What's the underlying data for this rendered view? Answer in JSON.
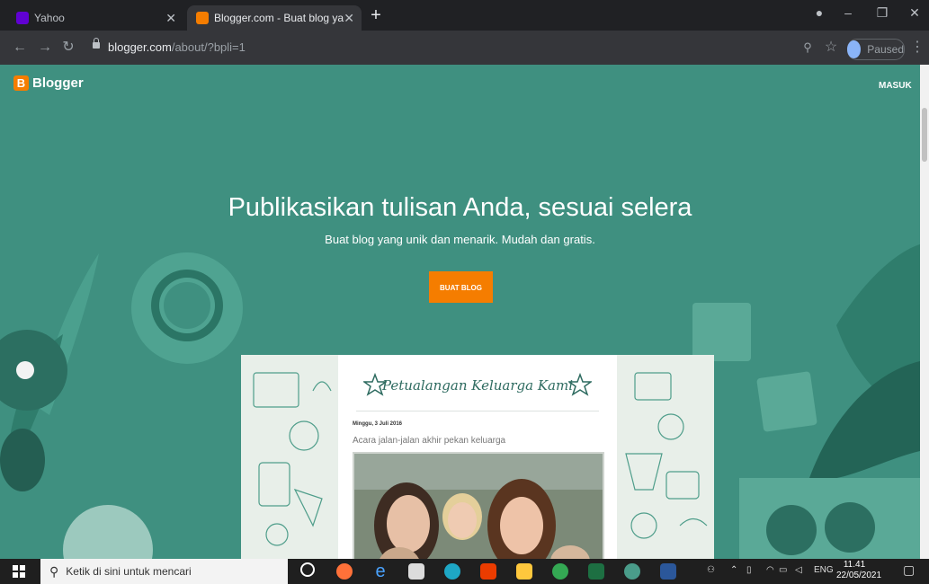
{
  "browser": {
    "tabs": [
      {
        "title": "Yahoo",
        "active": false
      },
      {
        "title": "Blogger.com - Buat blog yang u",
        "active": true
      }
    ],
    "url_host": "blogger.com",
    "url_path": "/about/?bpli=1",
    "profile_status": "Paused"
  },
  "page": {
    "logo_text": "Blogger",
    "signin_label": "MASUK",
    "headline": "Publikasikan tulisan Anda, sesuai selera",
    "subheadline": "Buat blog yang unik dan menarik. Mudah dan gratis.",
    "cta_label": "BUAT BLOG",
    "preview": {
      "blog_title": "Petualangan Keluarga Kami",
      "post_date": "Minggu, 3 Juli 2016",
      "post_title": "Acara jalan-jalan akhir pekan keluarga"
    }
  },
  "taskbar": {
    "search_placeholder": "Ketik di sini untuk mencari",
    "language": "ENG",
    "time": "11.41",
    "date": "22/05/2021"
  },
  "colors": {
    "page_bg": "#3f9080",
    "brand_orange": "#f57d00",
    "tab_strip": "#202124",
    "toolbar": "#35363a"
  }
}
